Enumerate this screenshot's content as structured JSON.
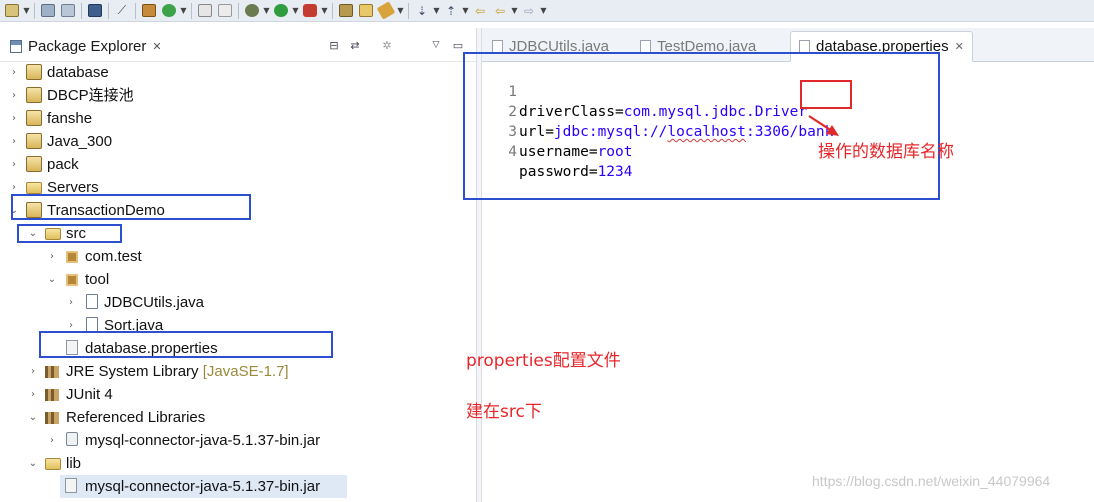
{
  "toolbar": {
    "icons": [
      "new-wizard-icon",
      "save-icon",
      "save-all-icon",
      "terminal-icon",
      "debug-skip-icon",
      "build-icon",
      "refresh-icon",
      "print-icon",
      "properties-icon",
      "debug-icon",
      "run-icon",
      "run-external-icon",
      "open-type-icon",
      "open-folder-icon",
      "search-tool-icon",
      "next-annotation-icon",
      "prev-annotation-icon",
      "last-edit-icon",
      "back-icon",
      "forward-icon"
    ]
  },
  "explorer": {
    "title": "Package Explorer",
    "close_glyph": "✕",
    "tree": [
      {
        "label": "database",
        "icon": "project-icon",
        "twisty": "collapsed"
      },
      {
        "label": "DBCP连接池",
        "icon": "project-icon",
        "twisty": "collapsed"
      },
      {
        "label": "fanshe",
        "icon": "project-icon",
        "twisty": "collapsed"
      },
      {
        "label": "Java_300",
        "icon": "project-icon",
        "twisty": "collapsed"
      },
      {
        "label": "pack",
        "icon": "project-icon",
        "twisty": "collapsed"
      },
      {
        "label": "Servers",
        "icon": "folder-icon",
        "twisty": "collapsed"
      },
      {
        "label": "TransactionDemo",
        "icon": "project-icon",
        "twisty": "expanded"
      },
      {
        "label": "src",
        "icon": "source-folder-icon",
        "twisty": "expanded"
      },
      {
        "label": "com.test",
        "icon": "package-icon",
        "twisty": "collapsed"
      },
      {
        "label": "tool",
        "icon": "package-icon",
        "twisty": "expanded"
      },
      {
        "label": "JDBCUtils.java",
        "icon": "java-file-icon",
        "twisty": "collapsed"
      },
      {
        "label": "Sort.java",
        "icon": "java-file-icon",
        "twisty": "collapsed"
      },
      {
        "label": "database.properties",
        "icon": "properties-file-icon",
        "twisty": "none"
      },
      {
        "label": "JRE System Library",
        "decoration": "[JavaSE-1.7]",
        "icon": "library-icon",
        "twisty": "collapsed"
      },
      {
        "label": "JUnit 4",
        "icon": "library-icon",
        "twisty": "collapsed"
      },
      {
        "label": "Referenced Libraries",
        "icon": "library-icon",
        "twisty": "expanded"
      },
      {
        "label": "mysql-connector-java-5.1.37-bin.jar",
        "icon": "jar-icon",
        "twisty": "collapsed"
      },
      {
        "label": "lib",
        "icon": "folder-icon",
        "twisty": "expanded"
      },
      {
        "label": "mysql-connector-java-5.1.37-bin.jar",
        "icon": "jar-file-icon",
        "twisty": "none",
        "selected": true
      }
    ]
  },
  "editor": {
    "tabs": [
      {
        "label": "JDBCUtils.java",
        "active": false
      },
      {
        "label": "TestDemo.java",
        "active": false
      },
      {
        "label": "database.properties",
        "active": true
      }
    ],
    "close_glyph": "✕",
    "lines": [
      {
        "num": "1",
        "key": "driverClass=",
        "value": "com.mysql.jdbc.Driver"
      },
      {
        "num": "2",
        "key": "url=",
        "value_pre": "jdbc:mysql://",
        "value_squig": "localhost",
        "value_mid": ":3306/",
        "value_end": "bank"
      },
      {
        "num": "3",
        "key": "username=",
        "value": "root"
      },
      {
        "num": "4",
        "key": "password=",
        "value": "1234"
      }
    ]
  },
  "annotations": {
    "db_name_note": "操作的数据库名称",
    "properties_note_latin": "properties",
    "properties_note_cn": "配置文件",
    "src_note_pre": "建在",
    "src_note_latin": "src",
    "src_note_post": "下",
    "box_color": "#2c4fcf",
    "note_color": "#e8262a"
  },
  "watermark": "https://blog.csdn.net/weixin_44079964"
}
